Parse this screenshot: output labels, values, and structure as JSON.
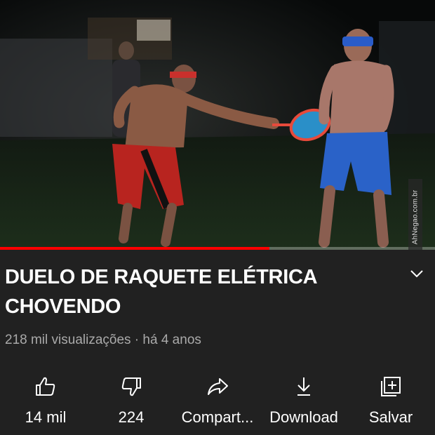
{
  "video": {
    "progress_fraction": 0.62,
    "watermark": "AhNegao.com.br"
  },
  "title": "DUELO DE RAQUETE ELÉTRICA CHOVENDO",
  "meta": {
    "views": "218 mil visualizações",
    "separator": " · ",
    "age": "há 4 anos"
  },
  "actions": [
    {
      "label": "14 mil",
      "icon": "thumbs-up-icon"
    },
    {
      "label": "224",
      "icon": "thumbs-down-icon"
    },
    {
      "label": "Compart...",
      "icon": "share-icon"
    },
    {
      "label": "Download",
      "icon": "download-icon"
    },
    {
      "label": "Salvar",
      "icon": "save-playlist-icon"
    }
  ],
  "colors": {
    "background": "#212121",
    "progress": "#ff0000",
    "meta_text": "#aaaaaa"
  }
}
